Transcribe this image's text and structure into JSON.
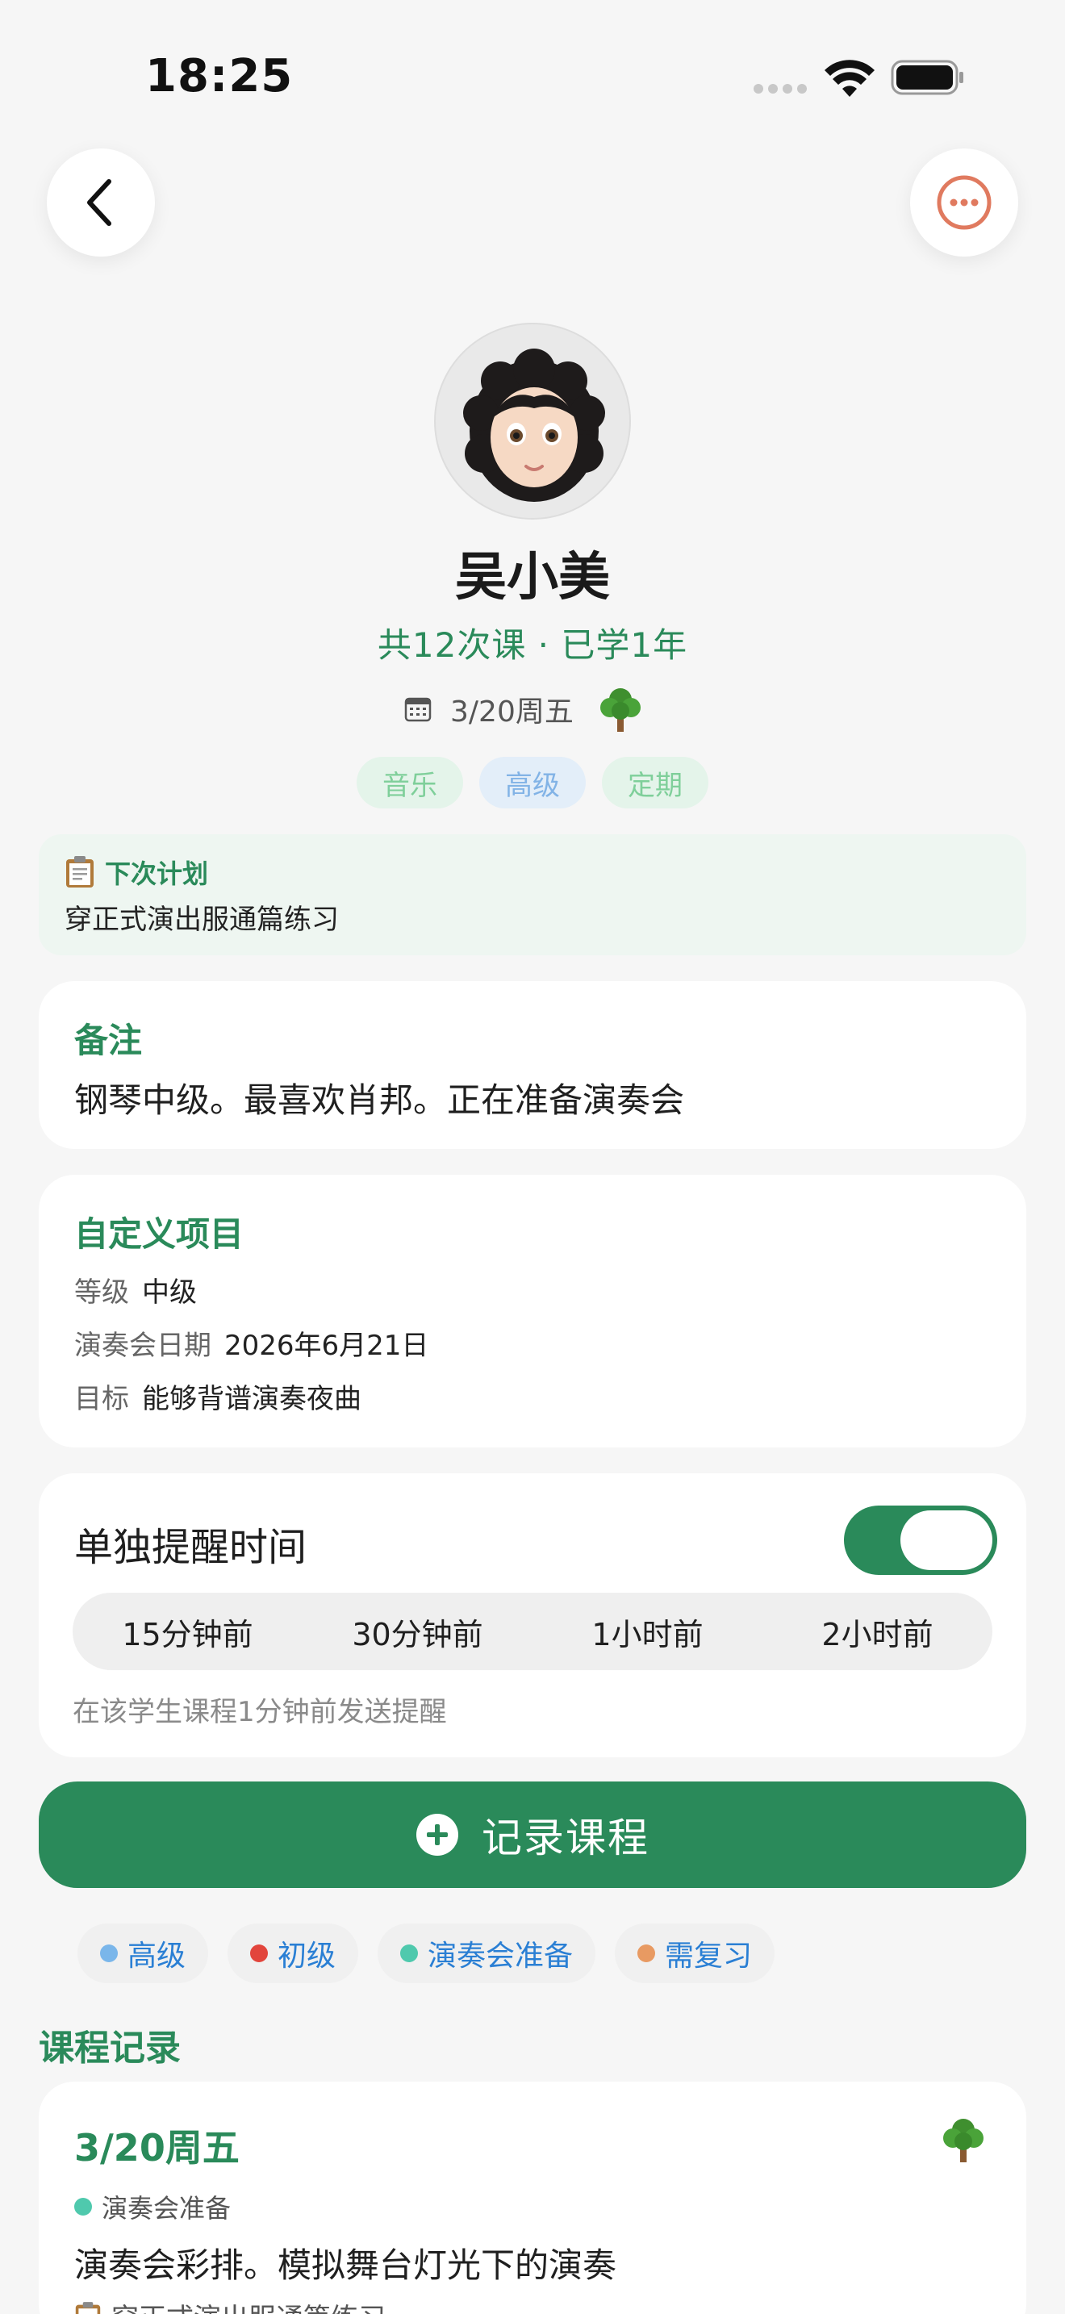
{
  "status_bar": {
    "time": "18:25"
  },
  "student": {
    "name": "吴小美",
    "summary": "共12次课 · 已学1年",
    "date": "3/20周五",
    "tags": [
      {
        "label": "音乐",
        "bg": "#e4f4ea",
        "color": "#7fcf9a"
      },
      {
        "label": "高级",
        "bg": "#e3eef9",
        "color": "#82b3e6"
      },
      {
        "label": "定期",
        "bg": "#e4f4ea",
        "color": "#7fcf9a"
      }
    ]
  },
  "next_plan": {
    "title": "下次计划",
    "text": "穿正式演出服通篇练习"
  },
  "note": {
    "title": "备注",
    "text": "钢琴中级。最喜欢肖邦。正在准备演奏会"
  },
  "custom_fields": {
    "title": "自定义项目",
    "items": [
      {
        "key": "等级",
        "value": "中级"
      },
      {
        "key": "演奏会日期",
        "value": "2026年6月21日"
      },
      {
        "key": "目标",
        "value": "能够背谱演奏夜曲"
      }
    ]
  },
  "reminder": {
    "title": "单独提醒时间",
    "enabled": true,
    "options": [
      "15分钟前",
      "30分钟前",
      "1小时前",
      "2小时前"
    ],
    "hint": "在该学生课程1分钟前发送提醒"
  },
  "record_button": {
    "label": "记录课程"
  },
  "legend": [
    {
      "label": "高级",
      "color": "#7ab6ea"
    },
    {
      "label": "初级",
      "color": "#e2453c"
    },
    {
      "label": "演奏会准备",
      "color": "#4fc9ad"
    },
    {
      "label": "需复习",
      "color": "#e89a62"
    }
  ],
  "records": {
    "title": "课程记录",
    "items": [
      {
        "date": "3/20周五",
        "tag": "演奏会准备",
        "tag_color": "#4fc9ad",
        "text": "演奏会彩排。模拟舞台灯光下的演奏",
        "plan": "穿正式演出服通篇练习"
      }
    ]
  },
  "colors": {
    "accent": "#2a8a5a",
    "more_icon": "#e07a5f"
  }
}
